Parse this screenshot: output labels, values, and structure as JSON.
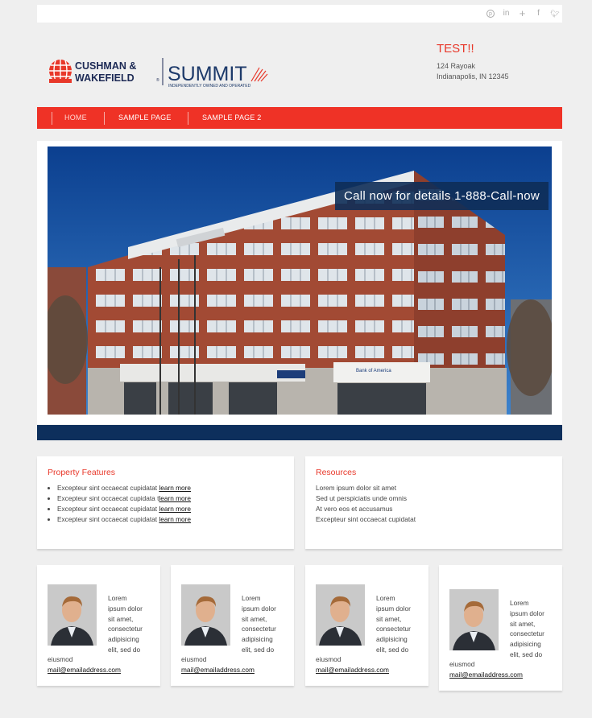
{
  "header": {
    "social_icons": [
      "pinterest-icon",
      "linkedin-icon",
      "google-plus-icon",
      "facebook-icon",
      "twitter-icon"
    ],
    "logo": {
      "brand1_line1": "CUSHMAN &",
      "brand1_line2": "WAKEFIELD",
      "brand2": "SUMMIT",
      "tagline": "INDEPENDENTLY OWNED AND OPERATED"
    },
    "contact": {
      "title": "TEST!!",
      "address1": "124 Rayoak",
      "address2": "Indianapolis, IN 12345"
    }
  },
  "nav": {
    "items": [
      {
        "label": "HOME"
      },
      {
        "label": "SAMPLE PAGE"
      },
      {
        "label": "SAMPLE PAGE 2"
      }
    ]
  },
  "hero": {
    "callout": "Call now for details 1-888-Call-now",
    "signs": [
      "Bank of America",
      "Bank of America"
    ]
  },
  "features": {
    "title": "Property Features",
    "items": [
      {
        "text": "Excepteur sint occaecat cupidatat ",
        "link": "learn more"
      },
      {
        "text": "Excepteur sint occaecat cupidata t",
        "link": "learn more"
      },
      {
        "text": "Excepteur sint occaecat cupidatat ",
        "link": "learn more"
      },
      {
        "text": "Excepteur sint occaecat cupidatat ",
        "link": "learn more"
      }
    ]
  },
  "resources": {
    "title": "Resources",
    "items": [
      "Lorem ipsum dolor sit amet",
      "Sed ut perspiciatis unde omnis",
      "At vero eos et accusamus",
      "Excepteur sint occaecat cupidatat"
    ]
  },
  "agents": [
    {
      "bio": [
        "Lorem",
        "ipsum dolor",
        "sit amet,",
        "consectetur",
        "adipisicing",
        "elit, sed do"
      ],
      "tail": "eiusmod",
      "email": "mail@emailaddress.com"
    },
    {
      "bio": [
        "Lorem",
        "ipsum dolor",
        "sit amet,",
        "consectetur",
        "adipisicing",
        "elit, sed do"
      ],
      "tail": "eiusmod",
      "email": "mail@emailaddress.com"
    },
    {
      "bio": [
        "Lorem",
        "ipsum dolor",
        "sit amet,",
        "consectetur",
        "adipisicing",
        "elit, sed do"
      ],
      "tail": "eiusmod",
      "email": "mail@emailaddress.com"
    },
    {
      "bio": [
        "Lorem",
        "ipsum dolor",
        "sit amet,",
        "consectetur",
        "adipisicing",
        "elit, sed do"
      ],
      "tail": "eiusmod",
      "email": "mail@emailaddress.com"
    }
  ],
  "colors": {
    "brand_red": "#ef3226",
    "navy": "#0d2f5c",
    "background": "#efefef"
  }
}
